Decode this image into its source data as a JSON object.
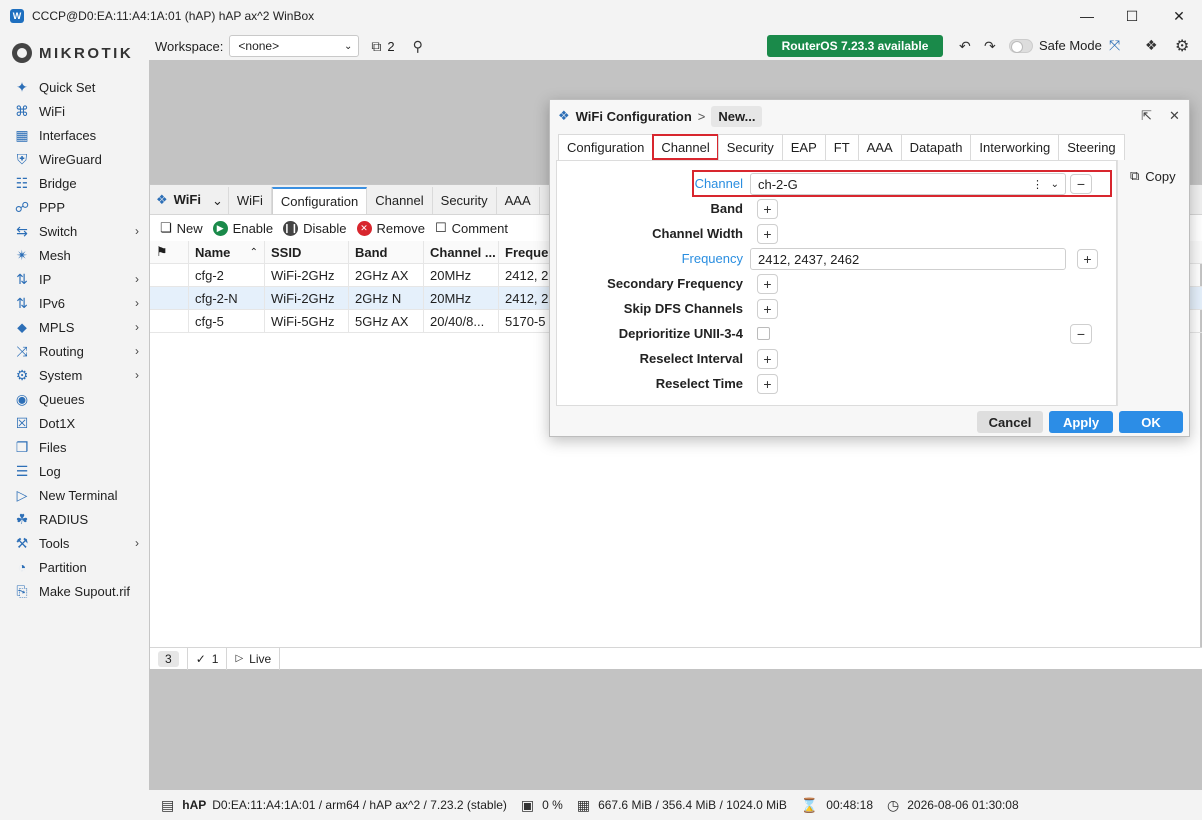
{
  "window": {
    "title": "CCCP@D0:EA:11:A4:1A:01 (hAP) hAP ax^2 WinBox"
  },
  "sidebar": {
    "logo_text": "MikroTik",
    "items": [
      {
        "label": "Quick Set",
        "icon": "wand-icon",
        "chevron": false
      },
      {
        "label": "WiFi",
        "icon": "wifi-icon",
        "chevron": false
      },
      {
        "label": "Interfaces",
        "icon": "interfaces-icon",
        "chevron": false
      },
      {
        "label": "WireGuard",
        "icon": "wireguard-icon",
        "chevron": false
      },
      {
        "label": "Bridge",
        "icon": "bridge-icon",
        "chevron": false
      },
      {
        "label": "PPP",
        "icon": "ppp-icon",
        "chevron": false
      },
      {
        "label": "Switch",
        "icon": "switch-icon",
        "chevron": true
      },
      {
        "label": "Mesh",
        "icon": "mesh-icon",
        "chevron": false
      },
      {
        "label": "IP",
        "icon": "ip-icon",
        "chevron": true
      },
      {
        "label": "IPv6",
        "icon": "ipv6-icon",
        "chevron": true
      },
      {
        "label": "MPLS",
        "icon": "mpls-icon",
        "chevron": true
      },
      {
        "label": "Routing",
        "icon": "routing-icon",
        "chevron": true
      },
      {
        "label": "System",
        "icon": "gear-icon",
        "chevron": true
      },
      {
        "label": "Queues",
        "icon": "queues-icon",
        "chevron": false
      },
      {
        "label": "Dot1X",
        "icon": "dot1x-icon",
        "chevron": false
      },
      {
        "label": "Files",
        "icon": "folder-icon",
        "chevron": false
      },
      {
        "label": "Log",
        "icon": "log-icon",
        "chevron": false
      },
      {
        "label": "New Terminal",
        "icon": "terminal-icon",
        "chevron": false
      },
      {
        "label": "RADIUS",
        "icon": "radius-icon",
        "chevron": false
      },
      {
        "label": "Tools",
        "icon": "tools-icon",
        "chevron": true
      },
      {
        "label": "Partition",
        "icon": "partition-icon",
        "chevron": false
      },
      {
        "label": "Make Supout.rif",
        "icon": "supout-icon",
        "chevron": false
      }
    ]
  },
  "toolbar": {
    "workspace_label": "Workspace:",
    "workspace_value": "<none>",
    "windows_count": "2",
    "update_label": "RouterOS 7.23.3 available",
    "safe_mode_label": "Safe Mode"
  },
  "wifi_window": {
    "title": "WiFi",
    "tabs": [
      "WiFi",
      "Configuration",
      "Channel",
      "Security",
      "AAA"
    ],
    "active_tab": "Configuration",
    "actions": {
      "new": "New",
      "enable": "Enable",
      "disable": "Disable",
      "remove": "Remove",
      "comment": "Comment"
    },
    "columns": [
      "Name",
      "SSID",
      "Band",
      "Channel ...",
      "Frequer"
    ],
    "rows": [
      {
        "name": "cfg-2",
        "ssid": "WiFi-2GHz",
        "band": "2GHz AX",
        "channel": "20MHz",
        "freq": "2412, 2",
        "selected": false
      },
      {
        "name": "cfg-2-N",
        "ssid": "WiFi-2GHz",
        "band": "2GHz N",
        "channel": "20MHz",
        "freq": "2412, 2",
        "selected": true
      },
      {
        "name": "cfg-5",
        "ssid": "WiFi-5GHz",
        "band": "5GHz AX",
        "channel": "20/40/8...",
        "freq": "5170-5",
        "selected": false
      }
    ],
    "status": {
      "count": "3",
      "checked": "1",
      "live_label": "Live"
    }
  },
  "dialog": {
    "title": "WiFi Configuration",
    "crumb": "New...",
    "tabs": [
      "Configuration",
      "Channel",
      "Security",
      "EAP",
      "FT",
      "AAA",
      "Datapath",
      "Interworking",
      "Steering"
    ],
    "active_tab": "Channel",
    "copy_label": "Copy",
    "fields": {
      "channel_label": "Channel",
      "channel_value": "ch-2-G",
      "band_label": "Band",
      "channel_width_label": "Channel Width",
      "frequency_label": "Frequency",
      "frequency_value": "2412, 2437, 2462",
      "secondary_frequency_label": "Secondary Frequency",
      "skip_dfs_label": "Skip DFS Channels",
      "deprioritize_label": "Deprioritize UNII-3-4",
      "reselect_interval_label": "Reselect Interval",
      "reselect_time_label": "Reselect Time"
    },
    "buttons": {
      "cancel": "Cancel",
      "apply": "Apply",
      "ok": "OK"
    }
  },
  "statusbar": {
    "device": "hAP",
    "details": "D0:EA:11:A4:1A:01 / arm64 / hAP ax^2 / 7.23.2 (stable)",
    "cpu": "0 %",
    "memory": "667.6 MiB / 356.4 MiB / 1024.0 MiB",
    "uptime": "00:48:18",
    "datetime": "2026-08-06 01:30:08"
  },
  "colors": {
    "accent": "#2c8de6",
    "update_green": "#1a8a4a",
    "highlight_red": "#d8262e"
  }
}
